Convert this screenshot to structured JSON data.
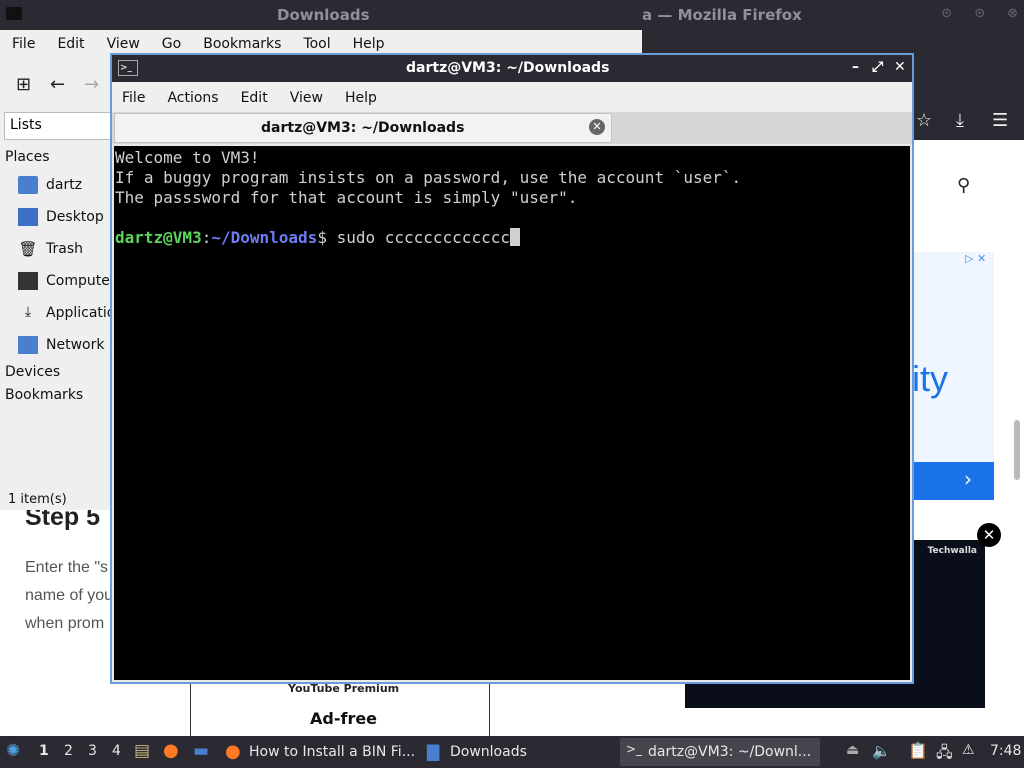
{
  "firefox": {
    "title_fragment": "a — Mozilla Firefox",
    "article": {
      "step_heading": "Step 5",
      "para_lines": [
        "Enter the \"s",
        "name of you",
        "when prom"
      ],
      "youtube_label": "YouTube Premium",
      "ad_free": "Ad-free",
      "ad_text": "ity",
      "video_brand": "Techwalla"
    }
  },
  "file_manager": {
    "title": "Downloads",
    "menu": [
      "File",
      "Edit",
      "View",
      "Go",
      "Bookmarks",
      "Tool",
      "Help"
    ],
    "lists_label": "Lists",
    "places_header": "Places",
    "places": [
      "dartz",
      "Desktop",
      "Trash",
      "Compute",
      "Applicatio",
      "Network"
    ],
    "devices_header": "Devices",
    "bookmarks_header": "Bookmarks",
    "status": "1 item(s)"
  },
  "terminal": {
    "title": "dartz@VM3: ~/Downloads",
    "menu": [
      "File",
      "Actions",
      "Edit",
      "View",
      "Help"
    ],
    "tab_label": "dartz@VM3: ~/Downloads",
    "lines": [
      "Welcome to VM3!",
      "If a buggy program insists on a password, use the account `user`.",
      "The passsword for that account is simply \"user\"."
    ],
    "prompt_user": "dartz@VM3",
    "prompt_sep": ":",
    "prompt_path": "~/Downloads",
    "prompt_end": "$ ",
    "command": "sudo ccccccccccccc"
  },
  "taskbar": {
    "workspaces": [
      "1",
      "2",
      "3",
      "4"
    ],
    "tasks": [
      {
        "label": "How to Install a BIN Fi..."
      },
      {
        "label": "Downloads"
      },
      {
        "label": "dartz@VM3: ~/Downl..."
      }
    ],
    "clock": "7:48"
  }
}
